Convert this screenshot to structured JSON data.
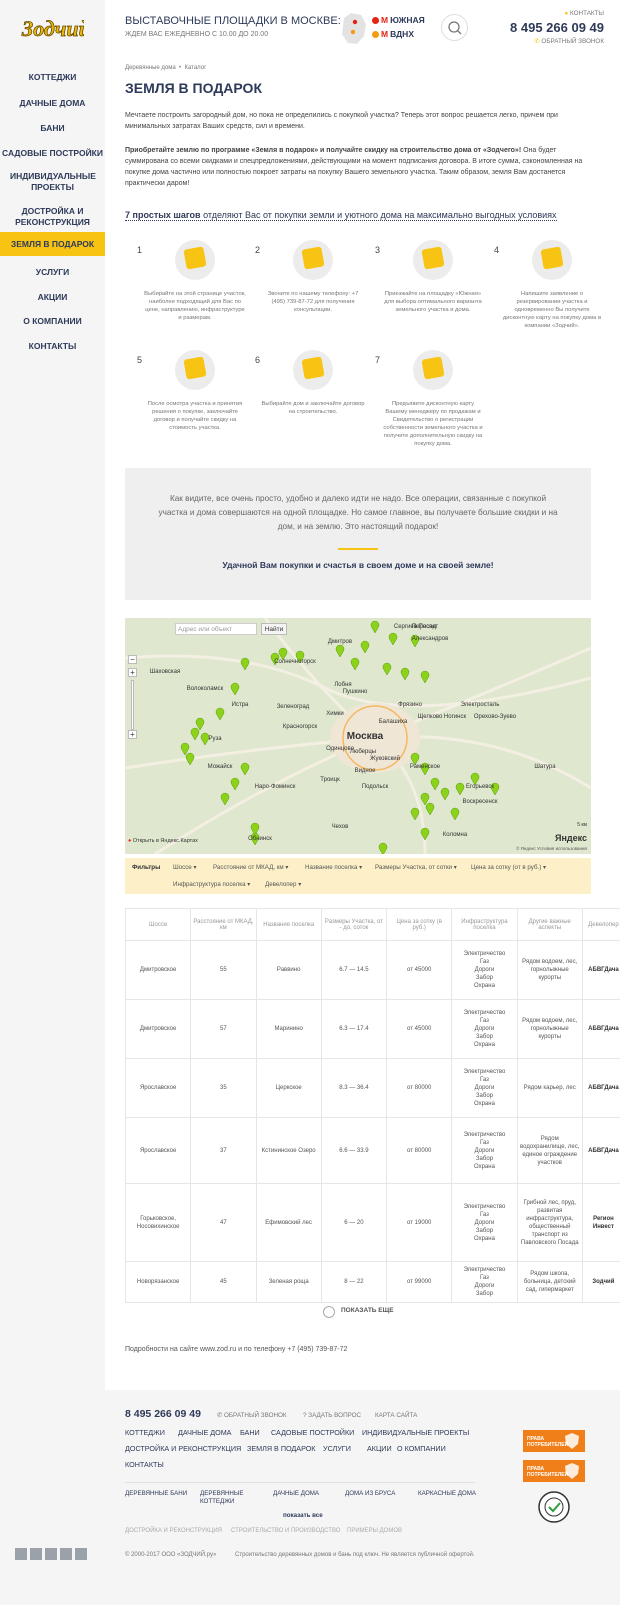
{
  "sidebar": {
    "logo_text": "Зодчий",
    "items": [
      "Коттеджи",
      "Дачные дома",
      "Бани",
      "Садовые постройки",
      "Индивидуальные проекты",
      "Достройка и реконструкция",
      "Земля в подарок",
      "Услуги",
      "Акции",
      "О компании",
      "Контакты"
    ],
    "active_index": 6
  },
  "header": {
    "title": "Выставочные площадки в Москве:",
    "subtitle": "Ждем вас ежедневно с 10.00 до 20.00",
    "metro": [
      "Южная",
      "ВДНХ"
    ],
    "contacts": "Контакты",
    "phone": "8 495 266 09 49",
    "callback": "Обратный звонок"
  },
  "breadcrumb": [
    "Деревянные дома",
    "Каталог"
  ],
  "page_title": "Земля в подарок",
  "intro": "Мечтаете построить загородный дом, но пока не определились с покупкой участка? Теперь этот вопрос решается легко, причем при минимальных затратах Ваших средств, сил и времени.",
  "program": {
    "bold": "Приобретайте землю по программе «Земля в подарок» и получайте скидку на строительство дома от «Зодчего»!",
    "rest": " Она будет суммирована со всеми скидками и спецпредложениями, действующими на момент подписания договора. В итоге сумма, сэкономленная на покупке дома частично или полностью покроет затраты на покупку Вашего земельного участка. Таким образом, земля Вам достанется практически даром!"
  },
  "steps_head": {
    "bold": "7 простых шагов",
    "rest": " отделяют Вас от покупки земли и уютного дома на максимально выгодных условиях"
  },
  "steps": [
    {
      "num": "1",
      "icon": "map-pin-icon",
      "text": "Выбирайте на этой странице участок, наиболее подходящий для Вас по цене, направлению, инфраструктуре и размерам."
    },
    {
      "num": "2",
      "icon": "phone-icon",
      "text": "Звоните по нашему телефону: +7 (495) 739-87-72 для получения консультации."
    },
    {
      "num": "3",
      "icon": "metro-icon",
      "text": "Приезжайте на площадку «Южная» для выбора оптимального варианта земельного участка и дома."
    },
    {
      "num": "4",
      "icon": "discount-card-icon",
      "text": "Напишите заявление о резервировании участка и одновременно Вы получите дисконтную карту на покупку дома в компании «Зодчий»."
    },
    {
      "num": "5",
      "icon": "discount-land-icon",
      "text": "После осмотра участка и принятия решения о покупке, заключайте договор и получайте скидку на стоимость участка."
    },
    {
      "num": "6",
      "icon": "contract-icon",
      "text": "Выбирайте дом и заключайте договор на строительство."
    },
    {
      "num": "7",
      "icon": "house-icon",
      "text": "Предъявите дисконтную карту Вашему менеджеру по продажам и Свидетельство о регистрации собственности земельного участка и получите дополнительную скидку на покупку дома."
    }
  ],
  "step2_phone": "(495) 739-87-72",
  "info_box": {
    "text": "Как видите, все очень просто, удобно и далеко идти не надо. Все операции, связанные с покупкой участка и дома совершаются на одной площадке. Но самое главное, вы получаете большие скидки и на дом, и на землю. Это настоящий подарок!",
    "wish": "Удачной Вам покупки и счастья в своем доме и на своей земле!"
  },
  "map": {
    "search_placeholder": "Адрес или объект",
    "search_button": "Найти",
    "open_link": "Открыть в Яндекс.Картах",
    "brand": "Яндекс",
    "scale": "5 км",
    "terms": "© Яндекс Условия использования",
    "cities": [
      "Дмитров",
      "Сергиев Посад",
      "Александров",
      "Солнечногорск",
      "Пушкино",
      "Фрязино",
      "Щелково",
      "Москва",
      "Красногорск",
      "Одинцово",
      "Балашиха",
      "Ногинск",
      "Люберцы",
      "Жуковский",
      "Видное",
      "Троицк",
      "Подольск",
      "Наро-Фоминск",
      "Чехов",
      "Воскресенск",
      "Коломна",
      "Раменское",
      "Зеленоград",
      "Лобня",
      "Химки",
      "Истра",
      "Руза",
      "Обнинск",
      "Орехово-Зуево",
      "Егорьевск",
      "Шатура",
      "Электросталь",
      "Пересвет",
      "Можайск",
      "Волоколамск",
      "Шаховская"
    ]
  },
  "filters": {
    "label": "Фильтры",
    "items": [
      "Шоссе",
      "Расстояние от МКАД, км",
      "Название поселка",
      "Размеры Участка, от сотки",
      "Цена за сотку (от в руб.)",
      "Инфраструктура поселка",
      "Девелопер"
    ]
  },
  "table": {
    "headers": [
      "Шоссе",
      "Расстояние от МКАД, км",
      "Название поселка",
      "Размеры Участка, от - до, соток",
      "Цена за сотку (в руб.)",
      "Инфраструктура поселка",
      "Другие важные аспекты",
      "Девелопер"
    ],
    "rows": [
      [
        "Дмитровское",
        "55",
        "Раввино",
        "6.7 — 14.5",
        "от 45000",
        "Электричество\nГаз\nДороги\nЗабор\nОхрана",
        "Рядом водоем, лес, горнолыжные курорты",
        "АБВГДача"
      ],
      [
        "Дмитровское",
        "57",
        "Маринино",
        "6.3 — 17.4",
        "от 45000",
        "Электричество\nГаз\nДороги\nЗабор\nОхрана",
        "Рядом водоем, лес, горнолыжные курорты",
        "АБВГДача"
      ],
      [
        "Ярославское",
        "35",
        "Церкское",
        "8.3 — 36.4",
        "от 80000",
        "Электричество\nГаз\nДороги\nЗабор\nОхрана",
        "Рядом карьер, лес",
        "АБВГДача"
      ],
      [
        "Ярославское",
        "37",
        "Кстининское Озеро",
        "6.6 — 33.9",
        "от 80000",
        "Электричество\nГаз\nДороги\nЗабор\nОхрана",
        "Рядом водохранилище, лес, единое ограждение участков",
        "АБВГДача"
      ],
      [
        "Горьковское, Носовихинское",
        "47",
        "Ефимовский лес",
        "6 — 20",
        "от 19000",
        "Электричество\nГаз\nДороги\nЗабор\nОхрана",
        "Грибной лес, пруд, развитая инфраструктура, общественный транспорт из Павловского Посада",
        "Регион Инвест"
      ],
      [
        "Новорязанское",
        "45",
        "Зеленая роща",
        "8 — 22",
        "от 99000",
        "Электричество\nГаз\nДороги\nЗабор",
        "Рядом школа, больница, детский сад, гипермаркет",
        "Зодчий"
      ]
    ]
  },
  "show_more": "Показать еще",
  "details": "Подробности на сайте www.zod.ru и по телефону +7 (495) 739-87-72",
  "footer": {
    "phone": "8 495 266 09 49",
    "callback": "Обратный звонок",
    "ask": "Задать вопрос",
    "sitemap": "Карта сайта",
    "nav_row1": [
      "Коттеджи",
      "Дачные дома",
      "Бани",
      "Садовые постройки",
      "Индивидуальные проекты"
    ],
    "nav_row2": [
      "Достройка и реконструкция",
      "Земля в подарок",
      "Услуги",
      "Акции",
      "О компании"
    ],
    "nav_row3": [
      "Контакты"
    ],
    "cats": [
      "Деревянные бани",
      "Деревянные коттеджи",
      "Дачные дома",
      "Дома из бруса",
      "Каркасные дома"
    ],
    "show_all": "показать все",
    "small": [
      "Достройка и реконструкция",
      "Строительство и производство",
      "Примеры домов"
    ],
    "copyright": "© 2000-2017 ООО «ЗОДЧИЙ.ру»",
    "disclaimer": "Строительство деревянных домов и бань под ключ. Не является публичной офертой.",
    "badge_text": "Права потребителей"
  },
  "colors": {
    "accent": "#f8c414",
    "navy": "#2e3a59",
    "marker": "#8cd21a"
  }
}
